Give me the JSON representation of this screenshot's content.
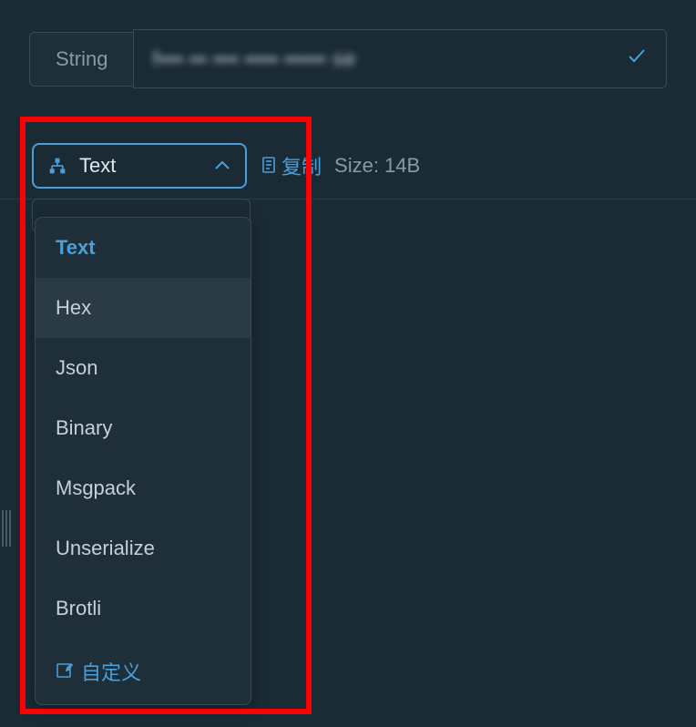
{
  "header": {
    "type_label": "String",
    "value_text": "f▪▪▪·▪▪·▪▪▪·▪▪▪▪·▪▪▪▪▪·se"
  },
  "format": {
    "current": "Text",
    "copy_label": "复制",
    "size_label": "Size: 14B"
  },
  "content": {
    "preview": "· · · · · ·"
  },
  "dropdown": {
    "options": [
      "Text",
      "Hex",
      "Json",
      "Binary",
      "Msgpack",
      "Unserialize",
      "Brotli"
    ],
    "custom_label": "自定义"
  }
}
